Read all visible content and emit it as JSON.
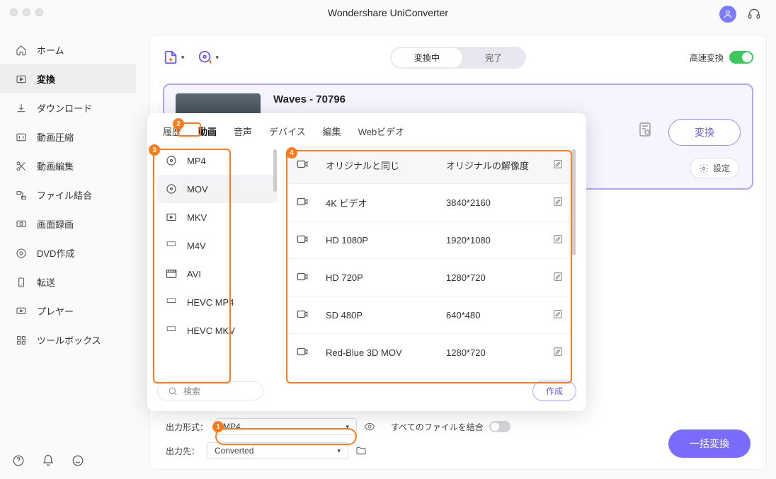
{
  "app_title": "Wondershare UniConverter",
  "header": {
    "turbo_label": "高速変換"
  },
  "sidebar": {
    "items": [
      {
        "label": "ホーム"
      },
      {
        "label": "変換"
      },
      {
        "label": "ダウンロード"
      },
      {
        "label": "動画圧縮"
      },
      {
        "label": "動画編集"
      },
      {
        "label": "ファイル結合"
      },
      {
        "label": "画面録画"
      },
      {
        "label": "DVD作成"
      },
      {
        "label": "転送"
      },
      {
        "label": "プレヤー"
      },
      {
        "label": "ツールボックス"
      }
    ]
  },
  "segments": {
    "converting": "変換中",
    "done": "完了"
  },
  "file": {
    "name": "Waves - 70796",
    "convert_btn": "変換",
    "settings_btn": "設定"
  },
  "dropdown": {
    "tabs": [
      "履歴",
      "動画",
      "音声",
      "デバイス",
      "編集",
      "Webビデオ"
    ],
    "formats": [
      "MP4",
      "MOV",
      "MKV",
      "M4V",
      "AVI",
      "HEVC MP4",
      "HEVC MKV"
    ],
    "resolutions": [
      {
        "label": "オリジナルと同じ",
        "value": "オリジナルの解像度"
      },
      {
        "label": "4K ビデオ",
        "value": "3840*2160"
      },
      {
        "label": "HD 1080P",
        "value": "1920*1080"
      },
      {
        "label": "HD 720P",
        "value": "1280*720"
      },
      {
        "label": "SD 480P",
        "value": "640*480"
      },
      {
        "label": "Red-Blue 3D MOV",
        "value": "1280*720"
      }
    ],
    "search_placeholder": "検索",
    "create_btn": "作成"
  },
  "bottom": {
    "output_format_label": "出力形式：",
    "output_format_value": "MP4",
    "merge_label": "すべてのファイルを結合",
    "output_dir_label": "出力先：",
    "output_dir_value": "Converted",
    "bulk_btn": "一括変換"
  },
  "callouts": {
    "1": "1",
    "2": "2",
    "3": "3",
    "4": "4"
  }
}
